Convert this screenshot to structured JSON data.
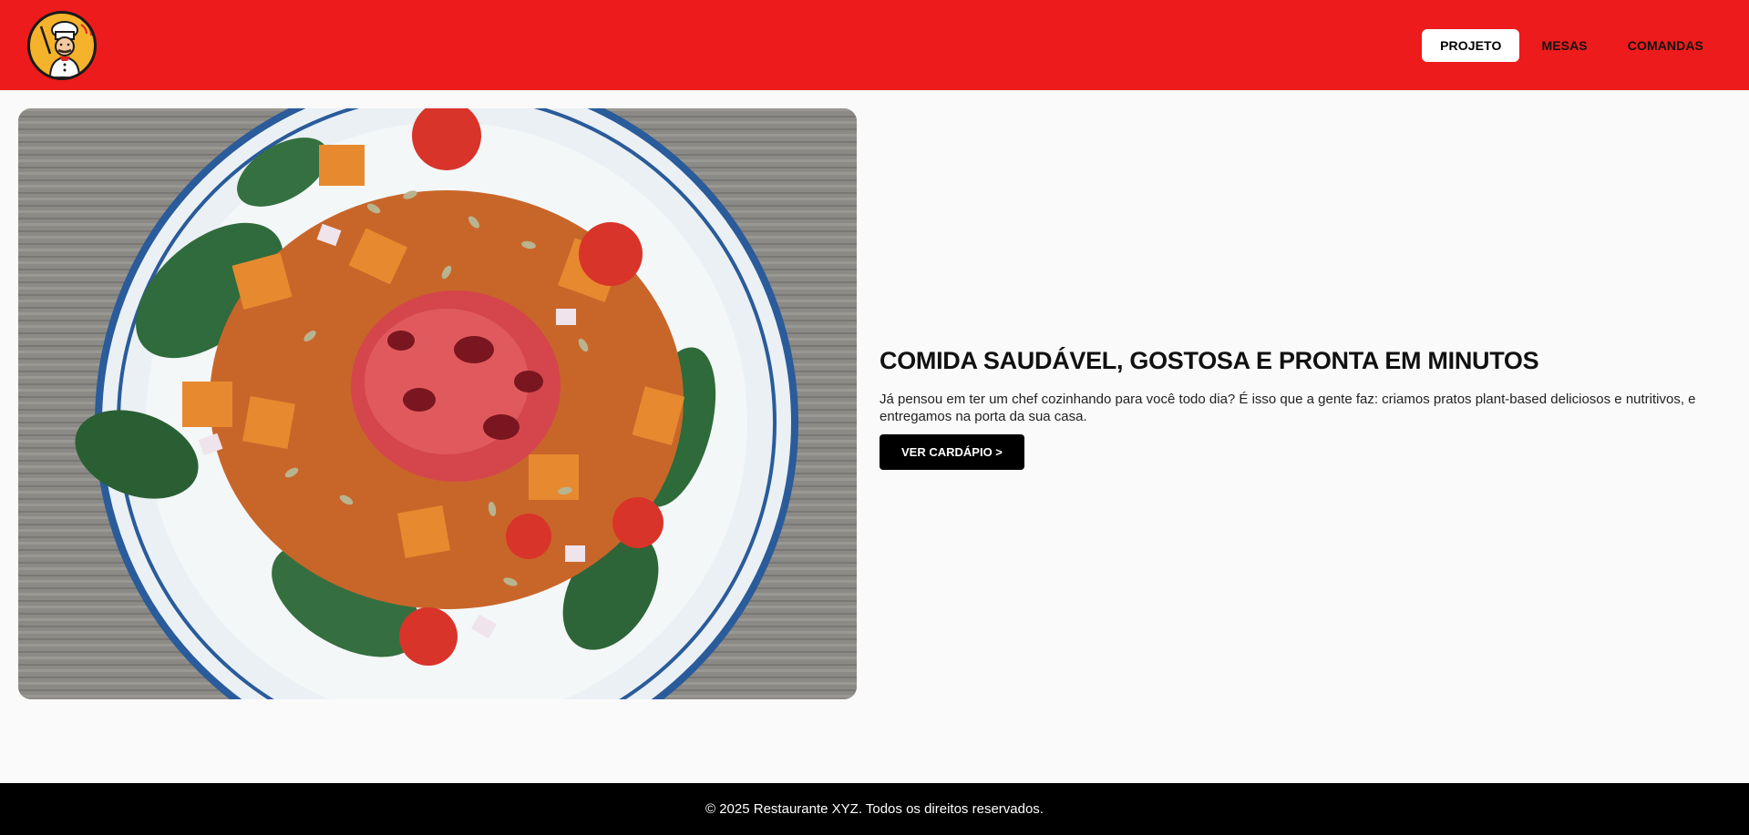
{
  "brand": {
    "logo_icon": "chef-mascot-icon"
  },
  "nav": {
    "items": [
      {
        "label": "PROJETO",
        "active": true
      },
      {
        "label": "MESAS",
        "active": false
      },
      {
        "label": "COMANDAS",
        "active": false
      }
    ]
  },
  "hero": {
    "image_icon": "salad-bowl-photo",
    "title": "COMIDA SAUDÁVEL, GOSTOSA E PRONTA EM MINUTOS",
    "description": "Já pensou em ter um chef cozinhando para você todo dia? É isso que a gente faz: criamos pratos plant-based deliciosos e nutritivos, e entregamos na porta da sua casa.",
    "cta_label": "VER CARDÁPIO >"
  },
  "footer": {
    "text": "© 2025 Restaurante XYZ. Todos os direitos reservados."
  },
  "colors": {
    "header_bg": "#ed1b1b",
    "footer_bg": "#000000",
    "page_bg": "#fafafa",
    "button_bg": "#000000"
  }
}
